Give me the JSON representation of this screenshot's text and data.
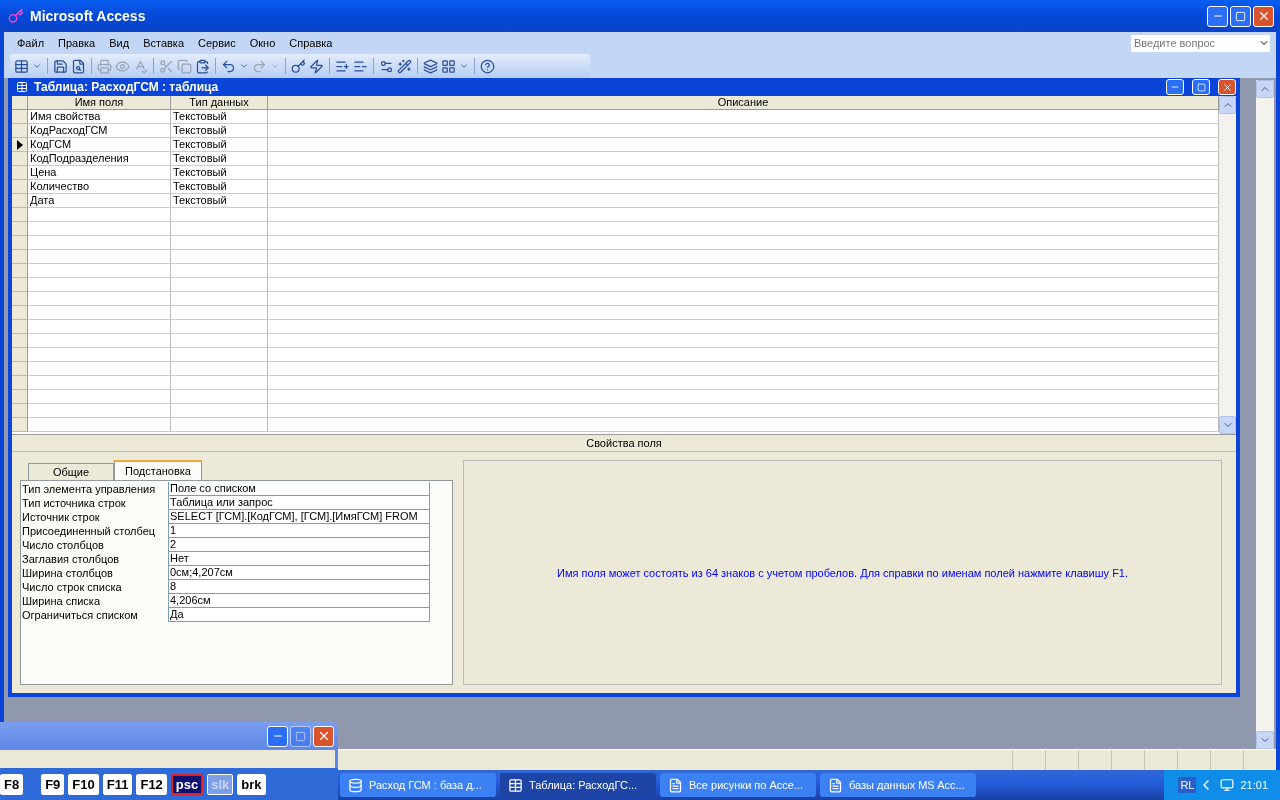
{
  "window": {
    "title": "Microsoft Access"
  },
  "menu": [
    "Файл",
    "Правка",
    "Вид",
    "Вставка",
    "Сервис",
    "Окно",
    "Справка"
  ],
  "question_box": {
    "placeholder": "Введите вопрос"
  },
  "table_window": {
    "title": "Таблица: РасходГСМ : таблица",
    "columns": [
      "Имя поля",
      "Тип данных",
      "Описание"
    ],
    "rows": [
      {
        "name": "Имя свойства",
        "type": "Текстовый",
        "selected": false
      },
      {
        "name": "КодРасходГСМ",
        "type": "Текстовый",
        "selected": false
      },
      {
        "name": "КодГСМ",
        "type": "Текстовый",
        "selected": true
      },
      {
        "name": "КодПодразделения",
        "type": "Текстовый",
        "selected": false
      },
      {
        "name": "Цена",
        "type": "Текстовый",
        "selected": false
      },
      {
        "name": "Количество",
        "type": "Текстовый",
        "selected": false
      },
      {
        "name": "Дата",
        "type": "Текстовый",
        "selected": false
      }
    ],
    "properties_caption": "Свойства поля",
    "tabs": [
      {
        "label": "Общие",
        "selected": false
      },
      {
        "label": "Подстановка",
        "selected": true
      }
    ],
    "properties": [
      {
        "label": "Тип элемента управления",
        "value": "Поле со списком"
      },
      {
        "label": "Тип источника строк",
        "value": "Таблица или запрос"
      },
      {
        "label": "Источник строк",
        "value": "SELECT [ГСМ].[КодГСМ], [ГСМ].[ИмяГСМ] FROM"
      },
      {
        "label": "Присоединенный столбец",
        "value": "1"
      },
      {
        "label": "Число столбцов",
        "value": "2"
      },
      {
        "label": "Заглавия столбцов",
        "value": "Нет"
      },
      {
        "label": "Ширина столбцов",
        "value": "0см;4,207см"
      },
      {
        "label": "Число строк списка",
        "value": "8"
      },
      {
        "label": "Ширина списка",
        "value": "4,206см"
      },
      {
        "label": "Ограничиться списком",
        "value": "Да"
      }
    ],
    "help_text": "Имя поля может состоять из 64 знаков с учетом пробелов.  Для справки по именам полей нажмите клавишу F1."
  },
  "keys_window": {
    "keys": [
      {
        "label": "F8",
        "selected": false,
        "disabled": false
      },
      {
        "label": "F9",
        "selected": false,
        "disabled": false
      },
      {
        "label": "F10",
        "selected": false,
        "disabled": false
      },
      {
        "label": "F11",
        "selected": false,
        "disabled": false
      },
      {
        "label": "F12",
        "selected": false,
        "disabled": false
      },
      {
        "label": "psc",
        "selected": true,
        "disabled": false
      },
      {
        "label": "slk",
        "selected": false,
        "disabled": true
      },
      {
        "label": "brk",
        "selected": false,
        "disabled": false
      }
    ]
  },
  "taskbar": {
    "items": [
      {
        "label": "Расход ГСМ : база д...",
        "kind": "database",
        "selected": false
      },
      {
        "label": "Таблица: РасходГС...",
        "kind": "table",
        "selected": true
      },
      {
        "label": "Все рисунки по Acce...",
        "kind": "document",
        "selected": false
      },
      {
        "label": "базы данных MS Acc...",
        "kind": "document",
        "selected": false
      }
    ],
    "language": "RL",
    "clock": "21:01"
  }
}
